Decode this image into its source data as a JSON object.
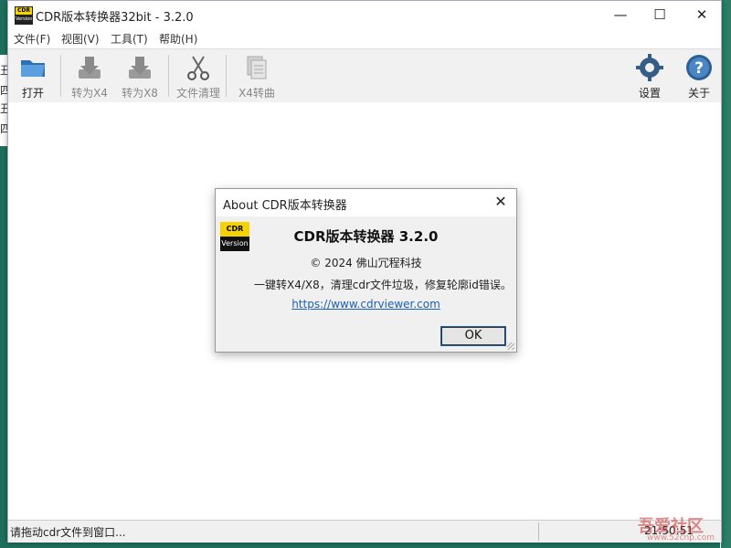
{
  "window": {
    "title": "CDR版本转换器32bit - 3.2.0",
    "icon_top": "CDR",
    "icon_bottom": "Version",
    "controls": {
      "minimize": "—",
      "maximize": "☐",
      "close": "✕"
    }
  },
  "menu": [
    {
      "label": "文件(F)"
    },
    {
      "label": "视图(V)"
    },
    {
      "label": "工具(T)"
    },
    {
      "label": "帮助(H)"
    }
  ],
  "toolbar": {
    "open_label": "打开",
    "to_x4_label": "转为X4",
    "to_x8_label": "转为X8",
    "clean_label": "文件清理",
    "x4_curve_label": "X4转曲",
    "settings_label": "设置",
    "about_label": "关于",
    "icons": {
      "open": "folder-icon",
      "to_x4": "download-icon",
      "to_x8": "download-icon",
      "clean": "scissors-icon",
      "x4_curve": "document-icon",
      "settings": "gear-icon",
      "about": "help-icon"
    }
  },
  "statusbar": {
    "message": "请拖动cdr文件到窗口...",
    "time": "21:50:51"
  },
  "dialog": {
    "title": "About CDR版本转换器",
    "close": "✕",
    "logo_top": "CDR",
    "logo_bottom": "Version",
    "heading": "CDR版本转换器 3.2.0",
    "copyright": "© 2024 佛山冗程科技",
    "description": "一键转X4/X8，清理cdr文件垃圾，修复轮廓id错误。",
    "link": "https://www.cdrviewer.com",
    "ok_label": "OK"
  },
  "background": {
    "left_chars": [
      "丑",
      "四",
      "丑",
      "四"
    ]
  },
  "watermark": {
    "text": "吾爱社区",
    "url": "www.52cnp.com"
  },
  "colors": {
    "accent": "#1a5fb4",
    "cdr_yellow": "#f5d200",
    "desktop": "#1f6f5c"
  }
}
